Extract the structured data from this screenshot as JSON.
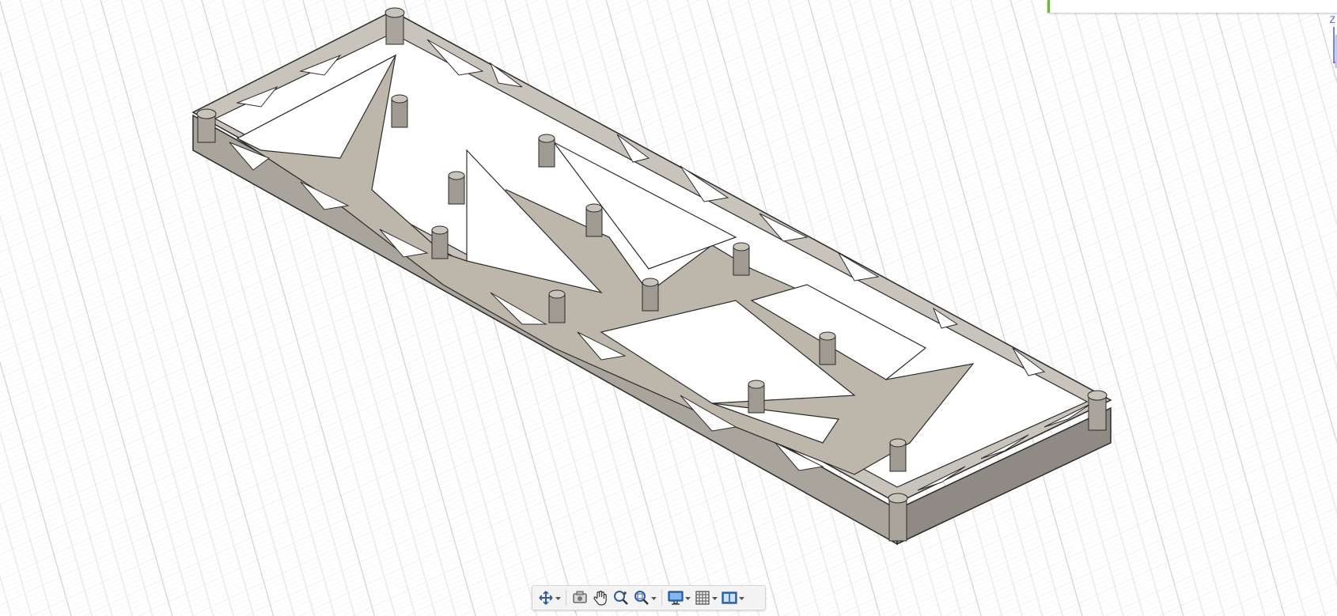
{
  "app": {
    "accent_color": "#6db33f",
    "canvas_bg": "#ffffff",
    "grid_color": "#d6d6d6",
    "model_face_color": "#c2bdb5",
    "model_edge_color": "#2b2b2b"
  },
  "viewcube": {
    "axis_label": "Z"
  },
  "navbar": {
    "buttons": [
      {
        "icon": "orbit-icon",
        "has_dropdown": true
      },
      {
        "icon": "look-at-icon",
        "has_dropdown": false
      },
      {
        "icon": "pan-hand-icon",
        "has_dropdown": false
      },
      {
        "icon": "zoom-icon",
        "has_dropdown": false
      },
      {
        "icon": "zoom-window-icon",
        "has_dropdown": true
      },
      {
        "icon": "display-settings-icon",
        "has_dropdown": true
      },
      {
        "icon": "grid-snaps-icon",
        "has_dropdown": true
      },
      {
        "icon": "viewports-icon",
        "has_dropdown": true
      }
    ]
  }
}
